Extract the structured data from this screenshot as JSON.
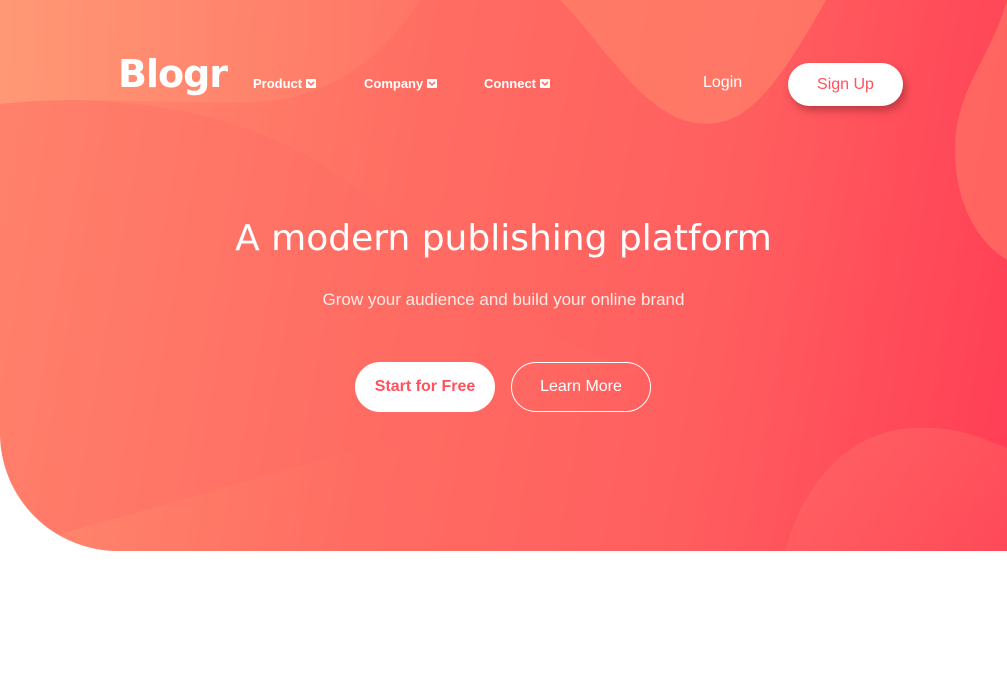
{
  "header": {
    "logo": "Blogr",
    "nav": [
      {
        "label": "Product",
        "icon": "chevron-down-icon"
      },
      {
        "label": "Company",
        "icon": "chevron-down-icon"
      },
      {
        "label": "Connect",
        "icon": "chevron-down-icon"
      }
    ],
    "login_label": "Login",
    "signup_label": "Sign Up"
  },
  "hero": {
    "title": "A modern publishing platform",
    "subtitle": "Grow your audience and build your online brand",
    "primary_cta": "Start for Free",
    "secondary_cta": "Learn More"
  },
  "colors": {
    "gradient_start": "#ff8f70",
    "gradient_end": "#ff3d55",
    "accent": "#ff525d",
    "text_light": "#ffffff"
  }
}
